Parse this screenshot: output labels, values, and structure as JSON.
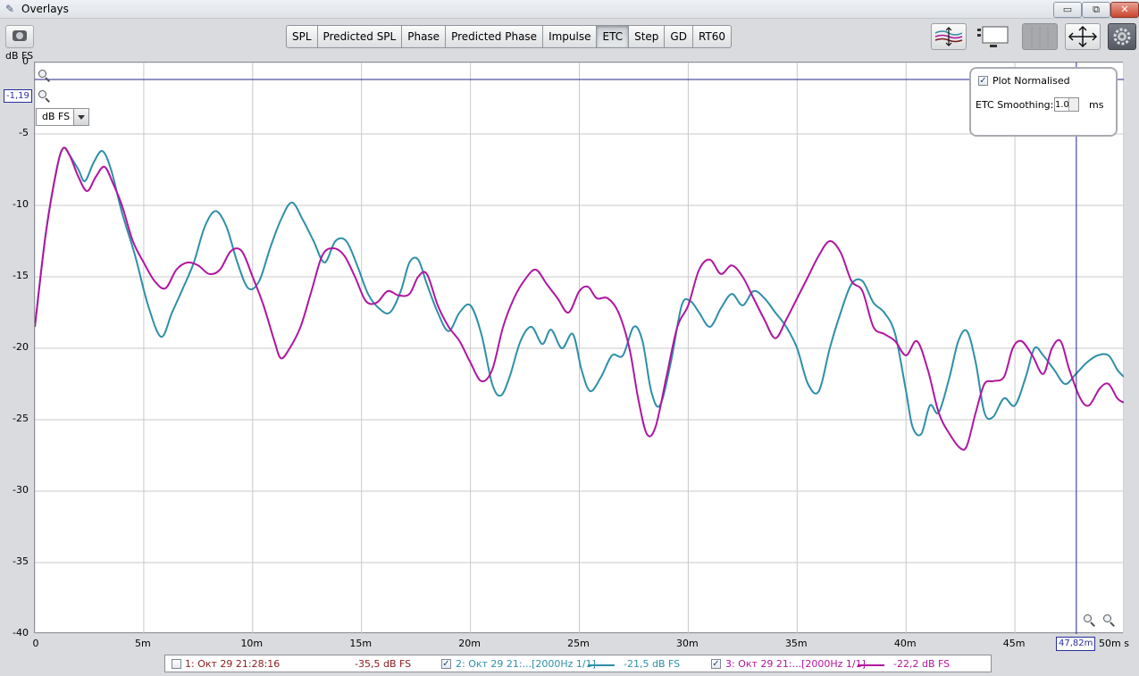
{
  "window": {
    "title": "Overlays",
    "minimize": "▭",
    "restore": "⧉",
    "close": "✕"
  },
  "tabs": [
    {
      "label": "SPL",
      "active": false
    },
    {
      "label": "Predicted SPL",
      "active": false
    },
    {
      "label": "Phase",
      "active": false
    },
    {
      "label": "Predicted Phase",
      "active": false
    },
    {
      "label": "Impulse",
      "active": false
    },
    {
      "label": "ETC",
      "active": true
    },
    {
      "label": "Step",
      "active": false
    },
    {
      "label": "GD",
      "active": false
    },
    {
      "label": "RT60",
      "active": false
    }
  ],
  "right_toolbar_icons": [
    "overlay-adjust-icon",
    "controls-panel-icon",
    "grid-toggle-icon",
    "move-arrows-icon",
    "settings-gear-icon"
  ],
  "y_unit": "dB FS",
  "y_select": "dB FS",
  "cursor": {
    "y_value": "-1,19",
    "x_value": "47,82m"
  },
  "panel": {
    "plot_normalised_label": "Plot Normalised",
    "plot_normalised_checked": true,
    "smoothing_label": "ETC Smoothing:",
    "smoothing_value": "1.0",
    "smoothing_unit": "ms"
  },
  "legend": [
    {
      "checked": false,
      "name": "1: Окт 29 21:28:16",
      "value": "-35,5 dB FS",
      "color": "#8b1a1a",
      "line": false
    },
    {
      "checked": true,
      "name": "2: Окт 29 21:...[2000Hz 1/1]",
      "value": "-21,5 dB FS",
      "color": "#2e8fa8",
      "line": true
    },
    {
      "checked": true,
      "name": "3: Окт 29 21:...[2000Hz 1/1]",
      "value": "-22,2 dB FS",
      "color": "#b0169f",
      "line": true
    }
  ],
  "chart_data": {
    "type": "line",
    "title": "",
    "xlabel": "ms",
    "ylabel": "dB FS",
    "xlim": [
      0,
      50
    ],
    "ylim": [
      -40,
      0
    ],
    "y_ticks": [
      "0",
      "-5",
      "-10",
      "-15",
      "-20",
      "-25",
      "-30",
      "-35",
      "-40"
    ],
    "x_ticks": [
      "0",
      "5m",
      "10m",
      "15m",
      "20m",
      "25m",
      "30m",
      "35m",
      "40m",
      "45m",
      "50m s"
    ],
    "grid": true,
    "cursor": {
      "x": 47.82,
      "y": -1.19
    },
    "series": [
      {
        "name": "2: Окт 29 21:...[2000Hz 1/1]",
        "color": "#2e8fa8",
        "points": [
          [
            0,
            -18.5
          ],
          [
            0.5,
            -12
          ],
          [
            1.0,
            -7.5
          ],
          [
            1.3,
            -6
          ],
          [
            1.6,
            -6.5
          ],
          [
            2.0,
            -7.5
          ],
          [
            2.3,
            -8.3
          ],
          [
            2.7,
            -7
          ],
          [
            3.1,
            -6.2
          ],
          [
            3.5,
            -7.5
          ],
          [
            4.0,
            -10.5
          ],
          [
            4.6,
            -13.5
          ],
          [
            5.2,
            -17
          ],
          [
            5.8,
            -19.2
          ],
          [
            6.3,
            -17.5
          ],
          [
            6.8,
            -15.8
          ],
          [
            7.3,
            -14
          ],
          [
            7.8,
            -11.5
          ],
          [
            8.3,
            -10.4
          ],
          [
            8.8,
            -11.5
          ],
          [
            9.3,
            -14
          ],
          [
            9.8,
            -15.8
          ],
          [
            10.3,
            -15.3
          ],
          [
            10.8,
            -13
          ],
          [
            11.3,
            -11
          ],
          [
            11.8,
            -9.8
          ],
          [
            12.3,
            -11
          ],
          [
            12.8,
            -12.5
          ],
          [
            13.3,
            -14
          ],
          [
            13.8,
            -12.5
          ],
          [
            14.3,
            -12.5
          ],
          [
            14.8,
            -14.2
          ],
          [
            15.3,
            -16.2
          ],
          [
            15.8,
            -17.2
          ],
          [
            16.3,
            -17.5
          ],
          [
            16.8,
            -16
          ],
          [
            17.2,
            -14
          ],
          [
            17.6,
            -13.8
          ],
          [
            18.0,
            -15.5
          ],
          [
            18.5,
            -17.5
          ],
          [
            19.0,
            -18.8
          ],
          [
            19.5,
            -17.5
          ],
          [
            20.0,
            -17
          ],
          [
            20.5,
            -19
          ],
          [
            21.0,
            -22.5
          ],
          [
            21.4,
            -23.3
          ],
          [
            21.8,
            -22
          ],
          [
            22.3,
            -19.5
          ],
          [
            22.8,
            -18.5
          ],
          [
            23.3,
            -19.7
          ],
          [
            23.7,
            -18.7
          ],
          [
            24.2,
            -20
          ],
          [
            24.7,
            -19
          ],
          [
            25.1,
            -21.5
          ],
          [
            25.5,
            -23
          ],
          [
            26.0,
            -22
          ],
          [
            26.5,
            -20.5
          ],
          [
            27.0,
            -20.5
          ],
          [
            27.5,
            -18.5
          ],
          [
            27.9,
            -19.5
          ],
          [
            28.3,
            -23
          ],
          [
            28.7,
            -24
          ],
          [
            29.2,
            -21
          ],
          [
            29.7,
            -17
          ],
          [
            30.1,
            -16.7
          ],
          [
            30.5,
            -17.5
          ],
          [
            31.0,
            -18.5
          ],
          [
            31.5,
            -17.2
          ],
          [
            32.0,
            -16.2
          ],
          [
            32.5,
            -17
          ],
          [
            33.0,
            -16
          ],
          [
            33.5,
            -16.5
          ],
          [
            34.0,
            -17.5
          ],
          [
            34.5,
            -18.5
          ],
          [
            35.0,
            -20
          ],
          [
            35.5,
            -22.5
          ],
          [
            36.0,
            -23
          ],
          [
            36.5,
            -20
          ],
          [
            37.0,
            -17.5
          ],
          [
            37.5,
            -15.5
          ],
          [
            38.0,
            -15.3
          ],
          [
            38.5,
            -16.8
          ],
          [
            39.0,
            -17.5
          ],
          [
            39.5,
            -19
          ],
          [
            40.0,
            -23
          ],
          [
            40.3,
            -25.5
          ],
          [
            40.7,
            -26
          ],
          [
            41.1,
            -24
          ],
          [
            41.5,
            -24.5
          ],
          [
            42.0,
            -22
          ],
          [
            42.4,
            -19.5
          ],
          [
            42.8,
            -18.8
          ],
          [
            43.2,
            -21
          ],
          [
            43.6,
            -24.5
          ],
          [
            44.0,
            -24.8
          ],
          [
            44.5,
            -23.5
          ],
          [
            45.0,
            -24
          ],
          [
            45.5,
            -22
          ],
          [
            45.9,
            -20
          ],
          [
            46.3,
            -20.5
          ],
          [
            46.8,
            -21.5
          ],
          [
            47.3,
            -22.5
          ],
          [
            47.8,
            -21.8
          ],
          [
            48.3,
            -21
          ],
          [
            48.8,
            -20.5
          ],
          [
            49.3,
            -20.5
          ],
          [
            49.7,
            -21.5
          ],
          [
            50.0,
            -22
          ]
        ]
      },
      {
        "name": "3: Окт 29 21:...[2000Hz 1/1]",
        "color": "#b0169f",
        "points": [
          [
            0,
            -18.5
          ],
          [
            0.5,
            -12
          ],
          [
            1.0,
            -7.5
          ],
          [
            1.3,
            -6
          ],
          [
            1.6,
            -6.5
          ],
          [
            2.0,
            -8
          ],
          [
            2.4,
            -9
          ],
          [
            2.8,
            -8
          ],
          [
            3.2,
            -7.3
          ],
          [
            3.6,
            -8.5
          ],
          [
            4.0,
            -10
          ],
          [
            4.5,
            -12.5
          ],
          [
            5.0,
            -14
          ],
          [
            5.5,
            -15.3
          ],
          [
            6.0,
            -15.8
          ],
          [
            6.5,
            -14.5
          ],
          [
            7.0,
            -14
          ],
          [
            7.5,
            -14.2
          ],
          [
            8.0,
            -14.8
          ],
          [
            8.5,
            -14.5
          ],
          [
            9.0,
            -13.2
          ],
          [
            9.5,
            -13.2
          ],
          [
            10.0,
            -15
          ],
          [
            10.5,
            -17
          ],
          [
            11.0,
            -19.5
          ],
          [
            11.3,
            -20.7
          ],
          [
            11.7,
            -20
          ],
          [
            12.2,
            -18.5
          ],
          [
            12.7,
            -16
          ],
          [
            13.2,
            -13.5
          ],
          [
            13.7,
            -13
          ],
          [
            14.2,
            -13.5
          ],
          [
            14.7,
            -15
          ],
          [
            15.2,
            -16.7
          ],
          [
            15.7,
            -16.8
          ],
          [
            16.2,
            -16
          ],
          [
            16.7,
            -16.3
          ],
          [
            17.2,
            -16.2
          ],
          [
            17.6,
            -15
          ],
          [
            18.0,
            -14.8
          ],
          [
            18.5,
            -17
          ],
          [
            19.0,
            -18.5
          ],
          [
            19.5,
            -19.5
          ],
          [
            20.0,
            -21
          ],
          [
            20.5,
            -22.3
          ],
          [
            21.0,
            -21.5
          ],
          [
            21.5,
            -18.5
          ],
          [
            22.0,
            -16.5
          ],
          [
            22.5,
            -15.2
          ],
          [
            23.0,
            -14.5
          ],
          [
            23.5,
            -15.5
          ],
          [
            24.0,
            -16.5
          ],
          [
            24.5,
            -17.5
          ],
          [
            25.0,
            -16
          ],
          [
            25.4,
            -15.7
          ],
          [
            25.8,
            -16.5
          ],
          [
            26.3,
            -16.5
          ],
          [
            26.8,
            -17.5
          ],
          [
            27.3,
            -20
          ],
          [
            27.7,
            -23.5
          ],
          [
            28.1,
            -26
          ],
          [
            28.5,
            -25.5
          ],
          [
            29.0,
            -22
          ],
          [
            29.5,
            -18.5
          ],
          [
            30.0,
            -17
          ],
          [
            30.5,
            -14.5
          ],
          [
            31.0,
            -13.8
          ],
          [
            31.5,
            -14.8
          ],
          [
            32.0,
            -14.2
          ],
          [
            32.5,
            -15
          ],
          [
            33.0,
            -16.5
          ],
          [
            33.5,
            -18
          ],
          [
            34.0,
            -19.3
          ],
          [
            34.5,
            -18
          ],
          [
            35.0,
            -16.5
          ],
          [
            35.5,
            -15
          ],
          [
            36.0,
            -13.5
          ],
          [
            36.5,
            -12.5
          ],
          [
            37.0,
            -13.3
          ],
          [
            37.5,
            -15.3
          ],
          [
            38.0,
            -16
          ],
          [
            38.5,
            -18.5
          ],
          [
            39.0,
            -19
          ],
          [
            39.5,
            -19.5
          ],
          [
            40.0,
            -20.5
          ],
          [
            40.5,
            -19.5
          ],
          [
            41.0,
            -21.5
          ],
          [
            41.5,
            -24.5
          ],
          [
            42.0,
            -26
          ],
          [
            42.5,
            -27
          ],
          [
            42.8,
            -26.8
          ],
          [
            43.2,
            -24.5
          ],
          [
            43.6,
            -22.5
          ],
          [
            44.0,
            -22.3
          ],
          [
            44.5,
            -22
          ],
          [
            44.9,
            -20
          ],
          [
            45.3,
            -19.5
          ],
          [
            45.8,
            -20.5
          ],
          [
            46.3,
            -21.8
          ],
          [
            46.7,
            -20
          ],
          [
            47.1,
            -19.5
          ],
          [
            47.5,
            -21.5
          ],
          [
            48.0,
            -23.5
          ],
          [
            48.4,
            -24
          ],
          [
            48.9,
            -22.8
          ],
          [
            49.3,
            -22.5
          ],
          [
            49.7,
            -23.5
          ],
          [
            50.0,
            -23.8
          ]
        ]
      }
    ]
  }
}
